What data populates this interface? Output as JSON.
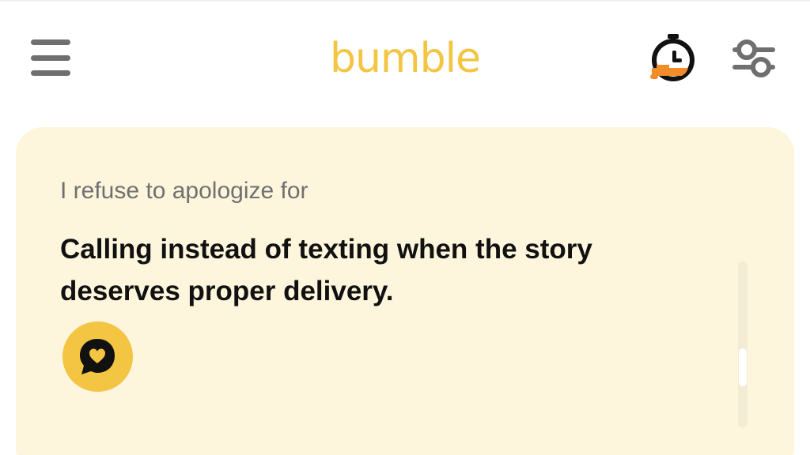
{
  "header": {
    "menu_icon": "hamburger-menu-icon",
    "logo": "bumble",
    "boost_icon": "stopwatch-boost-icon",
    "filter_icon": "sliders-filter-icon"
  },
  "card": {
    "prompt_label": "I refuse to apologize for",
    "prompt_answer": "Calling instead of texting when the story deserves proper delivery.",
    "compliment_icon": "heart-speech-bubble-icon"
  },
  "colors": {
    "brand_yellow": "#f4c542",
    "card_background": "#fdf5dc",
    "icon_gray": "#6f6f6f",
    "boost_orange": "#f28c28",
    "text_dark": "#111111",
    "text_muted": "#707070"
  }
}
